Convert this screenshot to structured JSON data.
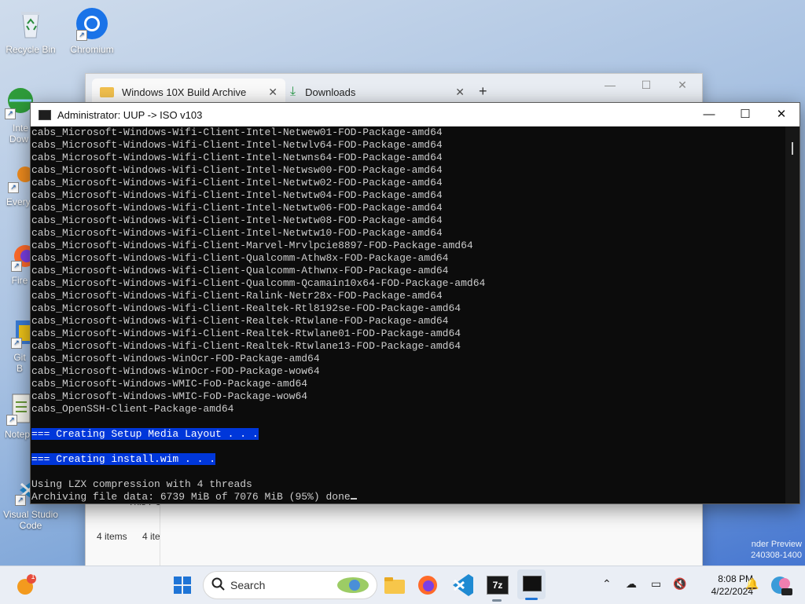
{
  "desktop": {
    "icons": [
      {
        "label": "Recycle Bin"
      },
      {
        "label": "Chromium"
      },
      {
        "label": "Inte Dow"
      },
      {
        "label": "Every"
      },
      {
        "label": "Fire"
      },
      {
        "label": "Git B"
      },
      {
        "label": "Notep"
      },
      {
        "label": "Visual Studio Code"
      }
    ]
  },
  "explorer": {
    "tabs": [
      {
        "label": "Windows 10X Build Archive"
      },
      {
        "label": "Downloads"
      }
    ],
    "new_tab": "+",
    "status_left": "4 items",
    "status_right": "4 ite",
    "partial_label": "This PC"
  },
  "console": {
    "title": "Administrator:  UUP -> ISO v103",
    "lines": [
      "cabs_Microsoft-Windows-Wifi-Client-Intel-Netwew01-FOD-Package-amd64",
      "cabs_Microsoft-Windows-Wifi-Client-Intel-Netwlv64-FOD-Package-amd64",
      "cabs_Microsoft-Windows-Wifi-Client-Intel-Netwns64-FOD-Package-amd64",
      "cabs_Microsoft-Windows-Wifi-Client-Intel-Netwsw00-FOD-Package-amd64",
      "cabs_Microsoft-Windows-Wifi-Client-Intel-Netwtw02-FOD-Package-amd64",
      "cabs_Microsoft-Windows-Wifi-Client-Intel-Netwtw04-FOD-Package-amd64",
      "cabs_Microsoft-Windows-Wifi-Client-Intel-Netwtw06-FOD-Package-amd64",
      "cabs_Microsoft-Windows-Wifi-Client-Intel-Netwtw08-FOD-Package-amd64",
      "cabs_Microsoft-Windows-Wifi-Client-Intel-Netwtw10-FOD-Package-amd64",
      "cabs_Microsoft-Windows-Wifi-Client-Marvel-Mrvlpcie8897-FOD-Package-amd64",
      "cabs_Microsoft-Windows-Wifi-Client-Qualcomm-Athw8x-FOD-Package-amd64",
      "cabs_Microsoft-Windows-Wifi-Client-Qualcomm-Athwnx-FOD-Package-amd64",
      "cabs_Microsoft-Windows-Wifi-Client-Qualcomm-Qcamain10x64-FOD-Package-amd64",
      "cabs_Microsoft-Windows-Wifi-Client-Ralink-Netr28x-FOD-Package-amd64",
      "cabs_Microsoft-Windows-Wifi-Client-Realtek-Rtl8192se-FOD-Package-amd64",
      "cabs_Microsoft-Windows-Wifi-Client-Realtek-Rtwlane-FOD-Package-amd64",
      "cabs_Microsoft-Windows-Wifi-Client-Realtek-Rtwlane01-FOD-Package-amd64",
      "cabs_Microsoft-Windows-Wifi-Client-Realtek-Rtwlane13-FOD-Package-amd64",
      "cabs_Microsoft-Windows-WinOcr-FOD-Package-amd64",
      "cabs_Microsoft-Windows-WinOcr-FOD-Package-wow64",
      "cabs_Microsoft-Windows-WMIC-FoD-Package-amd64",
      "cabs_Microsoft-Windows-WMIC-FoD-Package-wow64",
      "cabs_OpenSSH-Client-Package-amd64"
    ],
    "heading_setup": "=== Creating Setup Media Layout . . .",
    "heading_wim": "=== Creating install.wim . . .",
    "lzx_line": "Using LZX compression with 4 threads",
    "progress_line": "Archiving file data: 6739 MiB of 7076 MiB (95%) done",
    "highlight_color": "#0037da"
  },
  "watermark": {
    "line1": "nder Preview",
    "line2": "240308-1400"
  },
  "taskbar": {
    "search_label": "Search",
    "notification_badge": "1",
    "time": "8:08 PM",
    "date": "4/22/2024",
    "apps": [
      "start-icon",
      "search",
      "file-explorer-icon",
      "firefox-icon",
      "vscode-icon",
      "7zip-icon",
      "terminal-icon"
    ],
    "sevenzip_label": "7z"
  }
}
